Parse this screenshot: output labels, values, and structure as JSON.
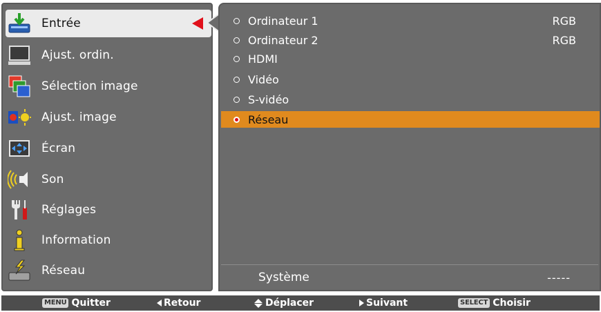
{
  "menu": {
    "items": [
      {
        "label": "Entrée",
        "icon": "input-icon",
        "selected": true
      },
      {
        "label": "Ajust. ordin.",
        "icon": "computer-adjust-icon"
      },
      {
        "label": "Sélection image",
        "icon": "image-select-icon"
      },
      {
        "label": "Ajust. image",
        "icon": "image-adjust-icon"
      },
      {
        "label": "Écran",
        "icon": "screen-icon"
      },
      {
        "label": "Son",
        "icon": "sound-icon"
      },
      {
        "label": "Réglages",
        "icon": "settings-icon"
      },
      {
        "label": "Information",
        "icon": "information-icon"
      },
      {
        "label": "Réseau",
        "icon": "network-icon"
      }
    ]
  },
  "options": {
    "items": [
      {
        "label": "Ordinateur 1",
        "value": "RGB"
      },
      {
        "label": "Ordinateur 2",
        "value": "RGB"
      },
      {
        "label": "HDMI",
        "value": ""
      },
      {
        "label": "Vidéo",
        "value": ""
      },
      {
        "label": "S-vidéo",
        "value": ""
      },
      {
        "label": "Réseau",
        "value": "",
        "selected": true
      }
    ],
    "system_label": "Système",
    "system_value": "-----"
  },
  "hints": {
    "menu_key": "MENU",
    "quit": "Quitter",
    "back": "Retour",
    "move": "Déplacer",
    "next": "Suivant",
    "select_key": "SELECT",
    "choose": "Choisir"
  },
  "colors": {
    "panel": "#6b6b6b",
    "highlight": "#e08a1e",
    "selected_menu": "#ebebeb",
    "arrow": "#e0101a"
  }
}
